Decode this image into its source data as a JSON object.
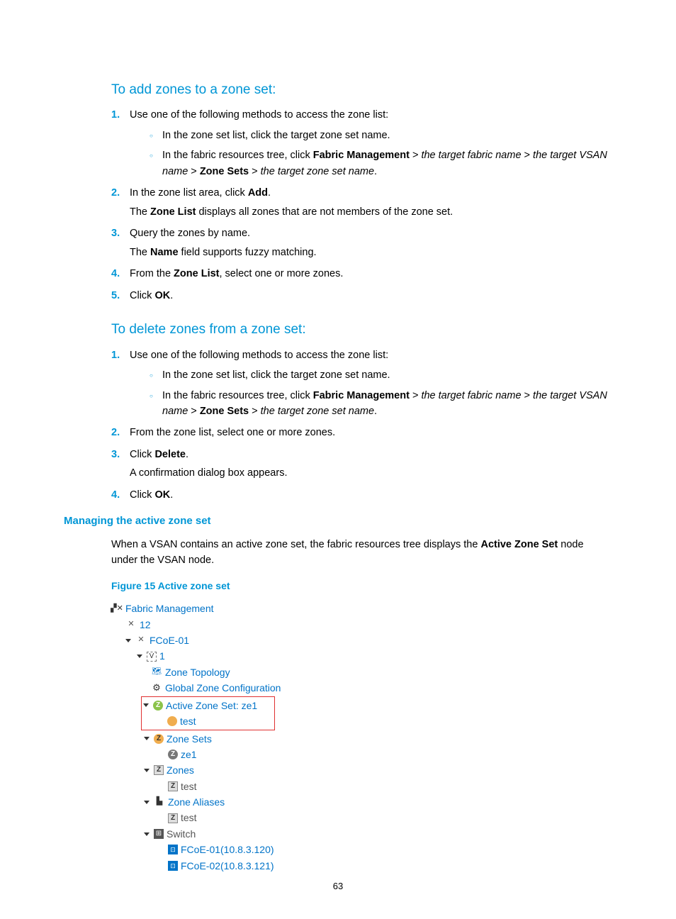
{
  "section1": {
    "heading": "To add zones to a zone set:",
    "steps": [
      {
        "num": "1.",
        "text": "Use one of the following methods to access the zone list:",
        "sub": [
          {
            "parts": [
              {
                "t": "In the zone set list, click the target zone set name."
              }
            ]
          },
          {
            "parts": [
              {
                "t": "In the fabric resources tree, click "
              },
              {
                "t": "Fabric Management",
                "b": true
              },
              {
                "t": " > "
              },
              {
                "t": "the target fabric name",
                "i": true
              },
              {
                "t": " > "
              },
              {
                "t": "the target VSAN name",
                "i": true
              },
              {
                "t": " > "
              },
              {
                "t": "Zone Sets",
                "b": true
              },
              {
                "t": " > "
              },
              {
                "t": "the target zone set name",
                "i": true
              },
              {
                "t": "."
              }
            ]
          }
        ]
      },
      {
        "num": "2.",
        "parts": [
          {
            "t": "In the zone list area, click "
          },
          {
            "t": "Add",
            "b": true
          },
          {
            "t": "."
          }
        ],
        "after_parts": [
          {
            "t": "The "
          },
          {
            "t": "Zone List",
            "b": true
          },
          {
            "t": " displays all zones that are not members of the zone set."
          }
        ]
      },
      {
        "num": "3.",
        "text": "Query the zones by name.",
        "after_parts": [
          {
            "t": "The "
          },
          {
            "t": "Name",
            "b": true
          },
          {
            "t": " field supports fuzzy matching."
          }
        ]
      },
      {
        "num": "4.",
        "parts": [
          {
            "t": "From the "
          },
          {
            "t": "Zone List",
            "b": true
          },
          {
            "t": ", select one or more zones."
          }
        ]
      },
      {
        "num": "5.",
        "parts": [
          {
            "t": "Click "
          },
          {
            "t": "OK",
            "b": true
          },
          {
            "t": "."
          }
        ]
      }
    ]
  },
  "section2": {
    "heading": "To delete zones from a zone set:",
    "steps": [
      {
        "num": "1.",
        "text": "Use one of the following methods to access the zone list:",
        "sub": [
          {
            "parts": [
              {
                "t": "In the zone set list, click the target zone set name."
              }
            ]
          },
          {
            "parts": [
              {
                "t": "In the fabric resources tree, click "
              },
              {
                "t": "Fabric Management",
                "b": true
              },
              {
                "t": " > "
              },
              {
                "t": "the target fabric name",
                "i": true
              },
              {
                "t": " > "
              },
              {
                "t": "the target VSAN name",
                "i": true
              },
              {
                "t": " > "
              },
              {
                "t": "Zone Sets",
                "b": true
              },
              {
                "t": " > "
              },
              {
                "t": "the target zone set name",
                "i": true
              },
              {
                "t": "."
              }
            ]
          }
        ]
      },
      {
        "num": "2.",
        "text": "From the zone list, select one or more zones."
      },
      {
        "num": "3.",
        "parts": [
          {
            "t": "Click "
          },
          {
            "t": "Delete",
            "b": true
          },
          {
            "t": "."
          }
        ],
        "after": "A confirmation dialog box appears."
      },
      {
        "num": "4.",
        "parts": [
          {
            "t": "Click "
          },
          {
            "t": "OK",
            "b": true
          },
          {
            "t": "."
          }
        ]
      }
    ]
  },
  "section3": {
    "heading": "Managing the active zone set",
    "para_parts": [
      {
        "t": "When a VSAN contains an active zone set, the fabric resources tree displays the "
      },
      {
        "t": "Active Zone Set",
        "b": true
      },
      {
        "t": " node under the VSAN node."
      }
    ],
    "figcap": "Figure 15 Active zone set"
  },
  "tree": {
    "n0": "Fabric Management",
    "n1": "12",
    "n2": "FCoE-01",
    "n3": "1",
    "n4": "Zone Topology",
    "n5": "Global Zone Configuration",
    "n6": "Active Zone Set: ze1",
    "n6a": "test",
    "n7": "Zone Sets",
    "n7a": "ze1",
    "n8": "Zones",
    "n8a": "test",
    "n9": "Zone Aliases",
    "n9a": "test",
    "n10": "Switch",
    "n10a": "FCoE-01(10.8.3.120)",
    "n10b": "FCoE-02(10.8.3.121)"
  },
  "pagenum": "63"
}
